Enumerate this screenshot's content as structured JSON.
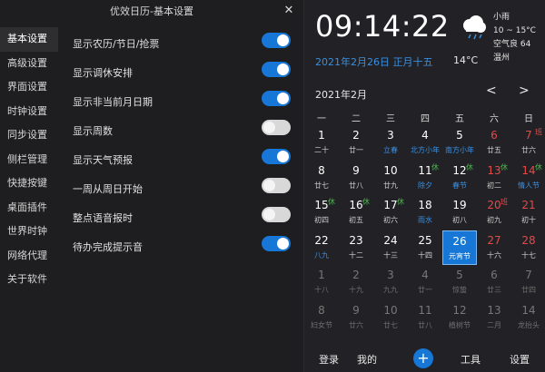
{
  "settings": {
    "title": "优效日历-基本设置",
    "close_icon": "close-icon",
    "nav": [
      "基本设置",
      "高级设置",
      "界面设置",
      "时钟设置",
      "同步设置",
      "侧栏管理",
      "快捷按键",
      "桌面插件",
      "世界时钟",
      "网络代理",
      "关于软件"
    ],
    "active_nav": 0,
    "options": [
      {
        "label": "显示农历/节日/抢票",
        "on": true
      },
      {
        "label": "显示调休安排",
        "on": true
      },
      {
        "label": "显示非当前月日期",
        "on": true
      },
      {
        "label": "显示周数",
        "on": false
      },
      {
        "label": "显示天气预报",
        "on": true
      },
      {
        "label": "一周从周日开始",
        "on": false
      },
      {
        "label": "整点语音报时",
        "on": false
      },
      {
        "label": "待办完成提示音",
        "on": true
      }
    ]
  },
  "calendar": {
    "time": "09:14:22",
    "date_line": "2021年2月26日 正月十五",
    "temp_now": "14°C",
    "weather_icon": "cloud-rain-icon",
    "weather": {
      "desc": "小雨",
      "range": "10 ~ 15°C",
      "aqi": "空气良 64",
      "city": "温州"
    },
    "month_label": "2021年2月",
    "prev": "<",
    "next": ">",
    "weekdays": [
      "一",
      "二",
      "三",
      "四",
      "五",
      "六",
      "日"
    ],
    "days": [
      {
        "n": "1",
        "l": "二十"
      },
      {
        "n": "2",
        "l": "廿一"
      },
      {
        "n": "3",
        "l": "立春",
        "term": true
      },
      {
        "n": "4",
        "l": "北方小年",
        "term": true
      },
      {
        "n": "5",
        "l": "南方小年",
        "term": true
      },
      {
        "n": "6",
        "l": "廿五",
        "weekend": true
      },
      {
        "n": "7",
        "l": "廿六",
        "weekend": true,
        "badge": "班"
      },
      {
        "n": "8",
        "l": "廿七"
      },
      {
        "n": "9",
        "l": "廿八"
      },
      {
        "n": "10",
        "l": "廿九"
      },
      {
        "n": "11",
        "l": "除夕",
        "term": true,
        "badge": "休"
      },
      {
        "n": "12",
        "l": "春节",
        "term": true,
        "badge": "休"
      },
      {
        "n": "13",
        "l": "初二",
        "weekend": true,
        "badge": "休"
      },
      {
        "n": "14",
        "l": "情人节",
        "term": true,
        "weekend": true,
        "badge": "休"
      },
      {
        "n": "15",
        "l": "初四",
        "badge": "休"
      },
      {
        "n": "16",
        "l": "初五",
        "badge": "休"
      },
      {
        "n": "17",
        "l": "初六",
        "badge": "休"
      },
      {
        "n": "18",
        "l": "雨水",
        "term": true
      },
      {
        "n": "19",
        "l": "初八"
      },
      {
        "n": "20",
        "l": "初九",
        "weekend": true,
        "badge": "班"
      },
      {
        "n": "21",
        "l": "初十",
        "weekend": true
      },
      {
        "n": "22",
        "l": "八九",
        "term": true
      },
      {
        "n": "23",
        "l": "十二"
      },
      {
        "n": "24",
        "l": "十三"
      },
      {
        "n": "25",
        "l": "十四"
      },
      {
        "n": "26",
        "l": "元宵节",
        "today": true
      },
      {
        "n": "27",
        "l": "十六",
        "weekend": true
      },
      {
        "n": "28",
        "l": "十七",
        "weekend": true
      },
      {
        "n": "1",
        "l": "十八",
        "muted": true
      },
      {
        "n": "2",
        "l": "十九",
        "muted": true
      },
      {
        "n": "3",
        "l": "九九",
        "muted": true
      },
      {
        "n": "4",
        "l": "廿一",
        "muted": true
      },
      {
        "n": "5",
        "l": "惊蛰",
        "muted": true
      },
      {
        "n": "6",
        "l": "廿三",
        "muted": true
      },
      {
        "n": "7",
        "l": "廿四",
        "muted": true
      },
      {
        "n": "8",
        "l": "妇女节",
        "muted": true
      },
      {
        "n": "9",
        "l": "廿六",
        "muted": true
      },
      {
        "n": "10",
        "l": "廿七",
        "muted": true
      },
      {
        "n": "11",
        "l": "廿八",
        "muted": true
      },
      {
        "n": "12",
        "l": "植树节",
        "muted": true
      },
      {
        "n": "13",
        "l": "二月",
        "muted": true
      },
      {
        "n": "14",
        "l": "龙抬头",
        "muted": true
      }
    ],
    "footer": {
      "login": "登录",
      "mine": "我的",
      "add": "+",
      "tools": "工具",
      "settings": "设置"
    }
  }
}
